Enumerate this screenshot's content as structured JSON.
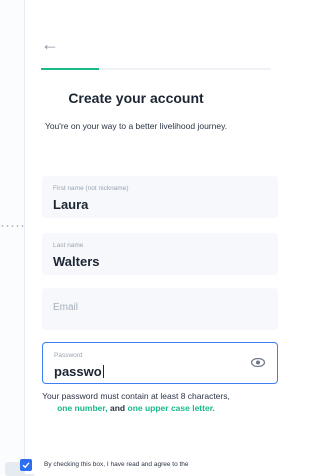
{
  "form": {
    "title": "Create your account",
    "subtitle": "You're on your way to a better livelihood journey.",
    "progress_fraction": 0.25,
    "fields": {
      "first_name": {
        "label": "First name (not nickname)",
        "value": "Laura"
      },
      "last_name": {
        "label": "Last name",
        "value": "Walters"
      },
      "email": {
        "placeholder": "Email"
      },
      "password": {
        "label": "Password",
        "value": "passwo"
      }
    },
    "password_hint": {
      "intro": "Your password must contain at least 8 characters,",
      "one_number": "one number,",
      "and": "and",
      "one_upper": "one upper case letter."
    },
    "consent_text": "By checking this box, I have read and agree to the",
    "consent_checked": true
  },
  "icons": {
    "back": "arrow-left-icon",
    "eye": "eye-icon",
    "check": "check-icon"
  },
  "colors": {
    "accent": "#19b98a",
    "focus": "#3d7ef4",
    "checkbox": "#2d6df0"
  }
}
